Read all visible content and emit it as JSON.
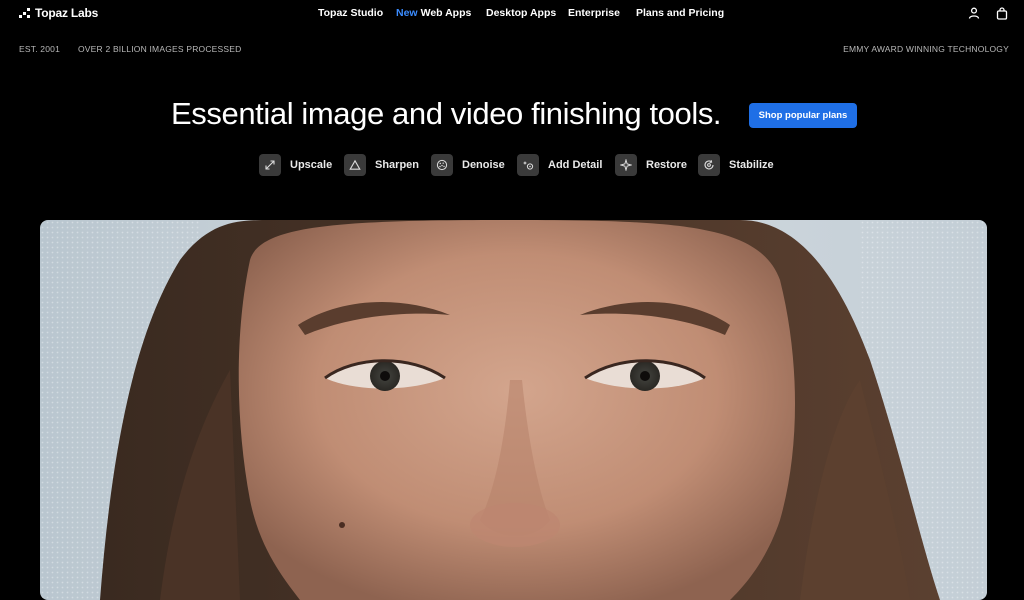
{
  "brand": {
    "name": "Topaz Labs"
  },
  "nav": {
    "items": [
      {
        "label": "Topaz Studio"
      },
      {
        "badge": "New",
        "label": "Web Apps"
      },
      {
        "label": "Desktop Apps"
      },
      {
        "label": "Enterprise"
      },
      {
        "label": "Plans and Pricing"
      }
    ],
    "icons": [
      "user-icon",
      "shopping-bag-icon"
    ]
  },
  "subbar": {
    "est": "EST. 2001",
    "processed": "OVER 2 BILLION IMAGES PROCESSED",
    "award": "EMMY AWARD WINNING TECHNOLOGY"
  },
  "hero": {
    "title": "Essential image and video finishing tools.",
    "cta": "Shop popular plans"
  },
  "features": [
    {
      "label": "Upscale",
      "icon": "expand-arrows-icon"
    },
    {
      "label": "Sharpen",
      "icon": "triangle-icon"
    },
    {
      "label": "Denoise",
      "icon": "grain-circle-icon"
    },
    {
      "label": "Add Detail",
      "icon": "sparkle-dots-icon"
    },
    {
      "label": "Restore",
      "icon": "star-sparkle-icon"
    },
    {
      "label": "Stabilize",
      "icon": "stabilize-circle-icon"
    }
  ],
  "colors": {
    "background": "#000000",
    "accent": "#1f6fe6",
    "new_badge": "#3b8cff"
  }
}
